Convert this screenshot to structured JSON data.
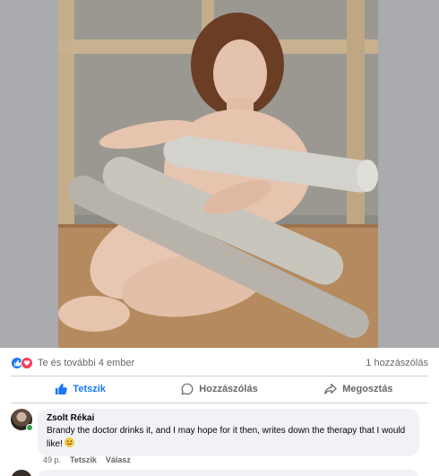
{
  "post": {
    "reactions": {
      "icons": [
        "like-icon",
        "love-icon"
      ],
      "summary": "Te és további 4 ember",
      "comments_count": "1 hozzászólás"
    },
    "actions": {
      "like": "Tetszik",
      "comment": "Hozzászólás",
      "share": "Megosztás"
    },
    "comment": {
      "author": "Zsolt Rékai",
      "text": "Brandy the doctor drinks it, and I may hope for it then, writes down the therapy that I would like!",
      "emoji": "smiley-emoji",
      "time": "49 p.",
      "like_label": "Tetszik",
      "reply_label": "Válasz"
    }
  },
  "colors": {
    "accent": "#1877f2",
    "love": "#f33e58",
    "muted_text": "#65676b",
    "bubble_bg": "#f0f2f5",
    "online": "#31a24c"
  }
}
